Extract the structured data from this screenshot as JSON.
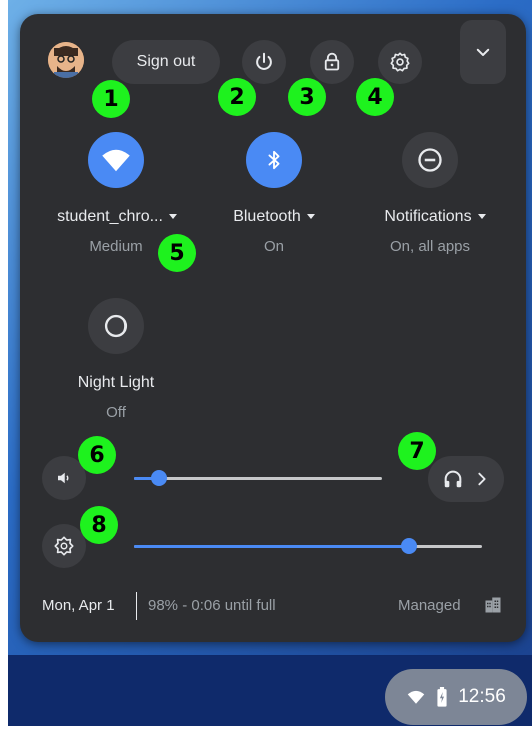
{
  "header": {
    "sign_out_label": "Sign out"
  },
  "tiles": [
    {
      "label": "student_chro...",
      "sub": "Medium",
      "active": true
    },
    {
      "label": "Bluetooth",
      "sub": "On",
      "active": true
    },
    {
      "label": "Notifications",
      "sub": "On, all apps",
      "active": false
    },
    {
      "label": "Night Light",
      "sub": "Off",
      "active": false
    }
  ],
  "sliders": {
    "volume_level": 0.1,
    "brightness_level": 0.79
  },
  "footer": {
    "date": "Mon, Apr 1",
    "battery": "98% - 0:06 until full",
    "managed": "Managed"
  },
  "shelf": {
    "time": "12:56"
  },
  "badges": [
    "1",
    "2",
    "3",
    "4",
    "5",
    "6",
    "7",
    "8"
  ],
  "colors": {
    "panel": "#2d2e31",
    "accent": "#4a8af4",
    "badge": "#1ef21e"
  }
}
